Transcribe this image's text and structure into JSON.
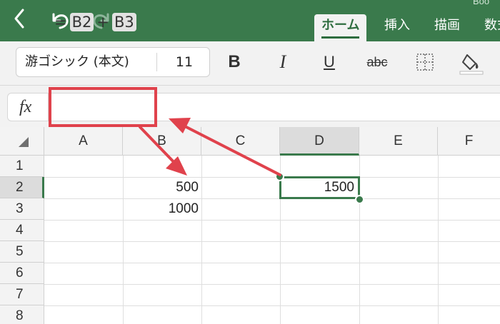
{
  "header": {
    "doc_title": "Boo",
    "tabs": [
      {
        "label": "ホーム",
        "active": true
      },
      {
        "label": "挿入",
        "active": false
      },
      {
        "label": "描画",
        "active": false
      },
      {
        "label": "数式",
        "active": false
      }
    ]
  },
  "ribbon": {
    "font_name": "游ゴシック (本文)",
    "font_size": "11",
    "bold_label": "B",
    "italic_label": "I",
    "underline_label": "U",
    "strike_label": "abc"
  },
  "formula_bar": {
    "fx_label": "fx",
    "equals": "=",
    "ref1": "B2",
    "operator": "+",
    "ref2": "B3"
  },
  "sheet": {
    "columns": [
      "A",
      "B",
      "C",
      "D",
      "E",
      "F"
    ],
    "selected_column": "D",
    "rows": [
      "1",
      "2",
      "3",
      "4",
      "5",
      "6",
      "7",
      "8"
    ],
    "selected_row": "2",
    "cells": {
      "B2": "500",
      "B3": "1000",
      "D2": "1500"
    },
    "active_cell": "D2"
  },
  "colors": {
    "app_green": "#3a7a4c",
    "annotation_red": "#e0424c"
  }
}
